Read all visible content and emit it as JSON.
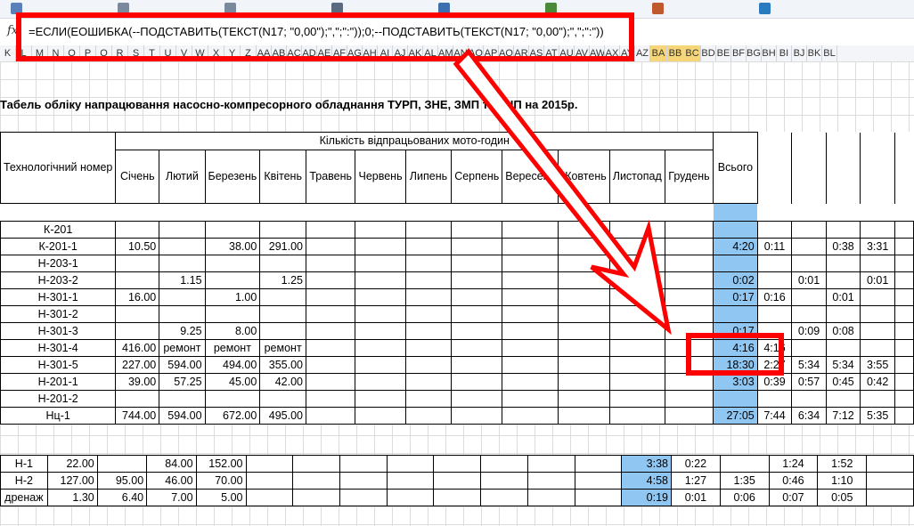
{
  "toolbar": {
    "icons": [
      "save-icon",
      "undo-icon",
      "redo-icon",
      "print-icon",
      "sort-icon",
      "filter-icon",
      "chart-icon",
      "help-icon"
    ]
  },
  "formula_bar": {
    "fx": "fx",
    "formula": "=ЕСЛИ(ЕОШИБКА(--ПОДСТАВИТЬ(ТЕКСТ(N17; \"0,00\");\",\";\":\"));0;--ПОДСТАВИТЬ(ТЕКСТ(N17; \"0,00\");\",\";\":\"))"
  },
  "columns": [
    "K",
    "L",
    "M",
    "N",
    "O",
    "P",
    "Q",
    "R",
    "S",
    "T",
    "U",
    "V",
    "W",
    "X",
    "Y",
    "Z",
    "AA",
    "AB",
    "AC",
    "AD",
    "AE",
    "AF",
    "AG",
    "AH",
    "AI",
    "AJ",
    "AK",
    "AL",
    "AM",
    "AN",
    "AO",
    "AP",
    "AQ",
    "AR",
    "AS",
    "AT",
    "AU",
    "AV",
    "AW",
    "AX",
    "AY",
    "AZ",
    "BA",
    "BB",
    "BC",
    "BD",
    "BE",
    "BF",
    "BG",
    "BH",
    "BI",
    "BJ",
    "BK",
    "BL"
  ],
  "sheet": {
    "title": "Табель обліку напрацювання насосно-компресорного обладнання ТУРП, ЗНЕ, ЗМП та УНП на 2015р.",
    "header": {
      "tech": "Технологічний номер",
      "group": "Кількість відпрацьованих мото-годин",
      "months": [
        "Січень",
        "Лютий",
        "Березень",
        "Квітень",
        "Травень",
        "Червень",
        "Липень",
        "Серпень",
        "Вересень",
        "Жовтень",
        "Листопад",
        "Грудень"
      ],
      "total": "Всього"
    },
    "rows": [
      {
        "name": "К-201",
        "m": [
          "",
          "",
          "",
          ""
        ],
        "total": "",
        "extra": [
          "",
          "",
          "",
          "",
          ""
        ]
      },
      {
        "name": "К-201-1",
        "m": [
          "10.50",
          "",
          "38.00",
          "291.00"
        ],
        "total": "4:20",
        "extra": [
          "0:11",
          "",
          "0:38",
          "3:31"
        ]
      },
      {
        "name": "Н-203-1",
        "m": [
          "",
          "",
          "",
          ""
        ],
        "total": "",
        "extra": [
          "",
          "",
          "",
          ""
        ]
      },
      {
        "name": "Н-203-2",
        "m": [
          "",
          "1.15",
          "",
          "1.25"
        ],
        "total": "0:02",
        "extra": [
          "",
          "0:01",
          "",
          "0:01"
        ]
      },
      {
        "name": "Н-301-1",
        "m": [
          "16.00",
          "",
          "1.00",
          ""
        ],
        "total": "0:17",
        "extra": [
          "0:16",
          "",
          "0:01",
          ""
        ]
      },
      {
        "name": "Н-301-2",
        "m": [
          "",
          "",
          "",
          ""
        ],
        "total": "",
        "extra": [
          "",
          "",
          "",
          ""
        ]
      },
      {
        "name": "Н-301-3",
        "m": [
          "",
          "9.25",
          "8.00",
          ""
        ],
        "total": "0:17",
        "extra": [
          "",
          "0:09",
          "0:08",
          ""
        ]
      },
      {
        "name": "Н-301-4",
        "m": [
          "416.00",
          "ремонт",
          "ремонт",
          "ремонт"
        ],
        "total": "4:16",
        "extra": [
          "4:16",
          "",
          "",
          ""
        ]
      },
      {
        "name": "Н-301-5",
        "m": [
          "227.00",
          "594.00",
          "494.00",
          "355.00"
        ],
        "total": "18:30",
        "extra": [
          "2:27",
          "5:34",
          "5:34",
          "3:55"
        ]
      },
      {
        "name": "Н-201-1",
        "m": [
          "39.00",
          "57.25",
          "45.00",
          "42.00"
        ],
        "total": "3:03",
        "extra": [
          "0:39",
          "0:57",
          "0:45",
          "0:42"
        ]
      },
      {
        "name": "Н-201-2",
        "m": [
          "",
          "",
          "",
          ""
        ],
        "total": "",
        "extra": [
          "",
          "",
          "",
          ""
        ]
      },
      {
        "name": "Нц-1",
        "m": [
          "744.00",
          "594.00",
          "672.00",
          "495.00"
        ],
        "total": "27:05",
        "extra": [
          "7:44",
          "6:34",
          "7:12",
          "5:35"
        ]
      }
    ],
    "rows2": [
      {
        "name": "Н-1",
        "m": [
          "22.00",
          "",
          "84.00",
          "152.00"
        ],
        "total": "3:38",
        "extra": [
          "0:22",
          "",
          "1:24",
          "1:52"
        ]
      },
      {
        "name": "Н-2",
        "m": [
          "127.00",
          "95.00",
          "46.00",
          "70.00"
        ],
        "total": "4:58",
        "extra": [
          "1:27",
          "1:35",
          "0:46",
          "1:10"
        ]
      },
      {
        "name": "дренаж",
        "m": [
          "1.30",
          "6.40",
          "7.00",
          "5.00"
        ],
        "total": "0:19",
        "extra": [
          "0:01",
          "0:06",
          "0:07",
          "0:05"
        ]
      }
    ]
  },
  "colors": {
    "highlight": "#8fc6f2",
    "annotation": "#ff0000",
    "header_select": "#f7d67a"
  }
}
